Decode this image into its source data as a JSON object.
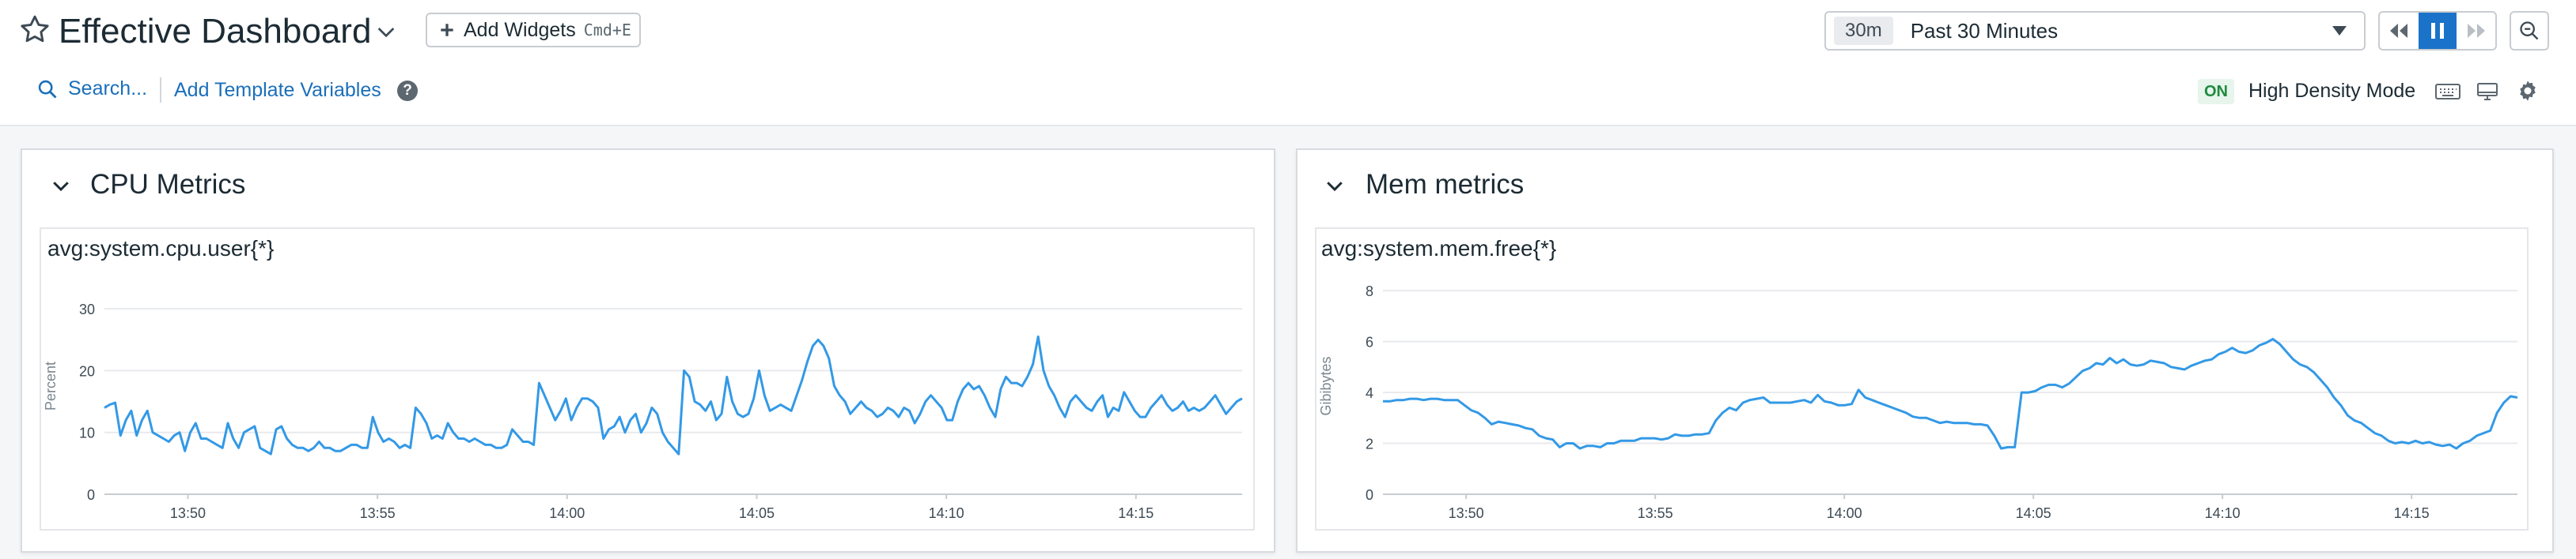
{
  "header": {
    "title": "Effective Dashboard",
    "add_widgets_label": "Add Widgets",
    "add_widgets_shortcut": "Cmd+E",
    "time_badge": "30m",
    "time_range": "Past 30 Minutes",
    "search_label": "Search...",
    "template_vars_label": "Add Template Variables",
    "help_glyph": "?",
    "high_density_badge": "ON",
    "high_density_label": "High Density Mode",
    "icons": [
      "star-icon",
      "chevron-down-icon",
      "plus-icon",
      "rewind-icon",
      "pause-icon",
      "fast-forward-icon",
      "zoom-out-icon",
      "search-icon",
      "help-icon",
      "keyboard-icon",
      "tv-mode-icon",
      "gear-icon"
    ]
  },
  "colors": {
    "series": "#3399e6",
    "link": "#1a6fba",
    "active_button": "#1a73c9",
    "on_badge_text": "#1e8a3d",
    "on_badge_bg": "#e7f5ec"
  },
  "groups": [
    {
      "title": "CPU Metrics",
      "widget_title": "avg:system.cpu.user{*}"
    },
    {
      "title": "Mem metrics",
      "widget_title": "avg:system.mem.free{*}"
    }
  ],
  "chart_data": [
    {
      "type": "line",
      "title": "avg:system.cpu.user{*}",
      "ylabel": "Percent",
      "xlabel": "",
      "ylim": [
        0,
        35
      ],
      "yticks": [
        0,
        10,
        20,
        30
      ],
      "x_ticks": [
        "13:50",
        "13:55",
        "14:00",
        "14:05",
        "14:10",
        "14:15"
      ],
      "x_tick_minutes": [
        2.2,
        7.2,
        12.2,
        17.2,
        22.2,
        27.2
      ],
      "x_range_minutes": [
        0,
        30
      ],
      "grid": true,
      "legend": "none",
      "series": [
        {
          "values": [
            14,
            14.5,
            14.8,
            9.5,
            12,
            13.5,
            9.5,
            12,
            13.5,
            10,
            9.5,
            9,
            8.5,
            9.5,
            10,
            7,
            10,
            11.5,
            9,
            9,
            8.5,
            8,
            7.5,
            11.5,
            9,
            7.5,
            10,
            10.5,
            11,
            7.5,
            7,
            6.5,
            10.5,
            11,
            9,
            8,
            7.5,
            7.5,
            7,
            7.5,
            8.5,
            7.5,
            7.5,
            7,
            7,
            7.5,
            8,
            8,
            7.5,
            7.5,
            12.5,
            10,
            8.5,
            9,
            8.5,
            7.5,
            8,
            7.5,
            14,
            13,
            11.5,
            9,
            9.5,
            9,
            11.5,
            10,
            9,
            9,
            8.5,
            9,
            8.5,
            8,
            8,
            7.5,
            7.5,
            8,
            10.5,
            9.5,
            8.5,
            8.5,
            8,
            18,
            16,
            14,
            12,
            13.5,
            15.5,
            12,
            14,
            15.5,
            15.5,
            15,
            14,
            9,
            10.5,
            11,
            12.5,
            10,
            12,
            13,
            10,
            11.5,
            14,
            13,
            10,
            8.5,
            7.5,
            6.5,
            20,
            19,
            15,
            14.5,
            13.5,
            15,
            12,
            13,
            19,
            15,
            13,
            12.5,
            13,
            15.5,
            20,
            16,
            13.5,
            14,
            14.5,
            14,
            13.5,
            16,
            18.5,
            21.5,
            24,
            25,
            24,
            22,
            17.5,
            16,
            15,
            13,
            14,
            15,
            14,
            13.5,
            12.5,
            13,
            14,
            13.5,
            12.5,
            14,
            13.5,
            11.5,
            13,
            15,
            16,
            15,
            14,
            12,
            12,
            15,
            17,
            18,
            17,
            17.5,
            16,
            14,
            12.5,
            17,
            19,
            18,
            18,
            17.5,
            19,
            21,
            25.5,
            20,
            17.5,
            16,
            14,
            12.5,
            15,
            16,
            15,
            14,
            13.5,
            15,
            16,
            12.5,
            14,
            13.5,
            16.5,
            15,
            13.5,
            12.5,
            12.5,
            14,
            15,
            16,
            14.5,
            13.5,
            14,
            15,
            13.5,
            14,
            13.5,
            14,
            15,
            16,
            14.5,
            13,
            14,
            15,
            15.5
          ]
        }
      ]
    },
    {
      "type": "line",
      "title": "avg:system.mem.free{*}",
      "ylabel": "Gibibytes",
      "xlabel": "",
      "ylim": [
        0,
        8.5
      ],
      "yticks": [
        0,
        2,
        4,
        6,
        8
      ],
      "x_ticks": [
        "13:50",
        "13:55",
        "14:00",
        "14:05",
        "14:10",
        "14:15"
      ],
      "x_tick_minutes": [
        2.2,
        7.2,
        12.2,
        17.2,
        22.2,
        27.2
      ],
      "x_range_minutes": [
        0,
        30
      ],
      "grid": true,
      "legend": "none",
      "series": [
        {
          "values": [
            3.65,
            3.65,
            3.7,
            3.7,
            3.75,
            3.75,
            3.7,
            3.75,
            3.75,
            3.7,
            3.7,
            3.7,
            3.5,
            3.3,
            3.2,
            3.0,
            2.75,
            2.85,
            2.8,
            2.75,
            2.7,
            2.6,
            2.55,
            2.3,
            2.2,
            2.15,
            1.85,
            2.0,
            2.0,
            1.8,
            1.9,
            1.9,
            1.85,
            2.0,
            2.0,
            2.1,
            2.1,
            2.1,
            2.2,
            2.2,
            2.2,
            2.15,
            2.2,
            2.35,
            2.3,
            2.3,
            2.35,
            2.35,
            2.4,
            2.9,
            3.2,
            3.4,
            3.3,
            3.6,
            3.7,
            3.75,
            3.8,
            3.6,
            3.6,
            3.6,
            3.6,
            3.65,
            3.7,
            3.6,
            3.9,
            3.65,
            3.6,
            3.5,
            3.5,
            3.55,
            4.1,
            3.8,
            3.7,
            3.6,
            3.5,
            3.4,
            3.3,
            3.2,
            3.05,
            3.0,
            3.0,
            2.9,
            2.8,
            2.85,
            2.8,
            2.8,
            2.8,
            2.75,
            2.75,
            2.7,
            2.3,
            1.8,
            1.85,
            1.85,
            4.0,
            4.0,
            4.05,
            4.2,
            4.3,
            4.3,
            4.2,
            4.35,
            4.6,
            4.85,
            4.95,
            5.15,
            5.1,
            5.35,
            5.15,
            5.3,
            5.1,
            5.05,
            5.1,
            5.25,
            5.2,
            5.15,
            5.0,
            4.95,
            4.9,
            5.05,
            5.15,
            5.25,
            5.3,
            5.5,
            5.6,
            5.75,
            5.6,
            5.55,
            5.65,
            5.85,
            5.95,
            6.1,
            5.9,
            5.6,
            5.3,
            5.1,
            5.0,
            4.8,
            4.5,
            4.2,
            3.8,
            3.5,
            3.1,
            2.9,
            2.8,
            2.6,
            2.4,
            2.3,
            2.1,
            2.0,
            2.05,
            2.0,
            2.1,
            2.0,
            2.05,
            1.95,
            1.9,
            1.95,
            1.8,
            2.0,
            2.1,
            2.3,
            2.4,
            2.5,
            3.2,
            3.6,
            3.85,
            3.8
          ]
        }
      ]
    }
  ]
}
